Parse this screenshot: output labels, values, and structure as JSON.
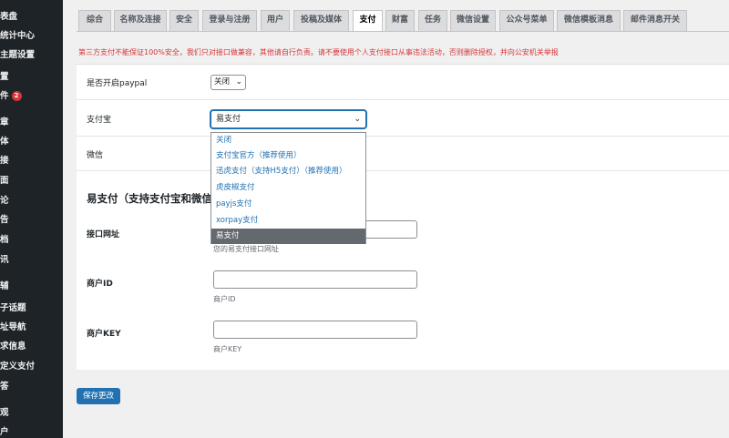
{
  "sidebar": {
    "items": [
      {
        "label": "表盘"
      },
      {
        "label": "统计中心"
      },
      {
        "label": "主题设置"
      },
      {
        "label": "置"
      },
      {
        "label": "件",
        "badge": "2"
      },
      {
        "label": "章"
      },
      {
        "label": "体"
      },
      {
        "label": "接"
      },
      {
        "label": "面"
      },
      {
        "label": "论"
      },
      {
        "label": "告"
      },
      {
        "label": "档"
      },
      {
        "label": "讯"
      },
      {
        "label": "辅"
      },
      {
        "label": "子话题"
      },
      {
        "label": "址导航"
      },
      {
        "label": "求信息"
      },
      {
        "label": "定义支付"
      },
      {
        "label": "答"
      },
      {
        "label": "观"
      },
      {
        "label": "户"
      }
    ]
  },
  "tabs": [
    {
      "label": "综合"
    },
    {
      "label": "名称及连接"
    },
    {
      "label": "安全"
    },
    {
      "label": "登录与注册"
    },
    {
      "label": "用户"
    },
    {
      "label": "投稿及媒体"
    },
    {
      "label": "支付",
      "active": true
    },
    {
      "label": "财富"
    },
    {
      "label": "任务"
    },
    {
      "label": "微信设置"
    },
    {
      "label": "公众号菜单"
    },
    {
      "label": "微信模板消息"
    },
    {
      "label": "邮件消息开关"
    }
  ],
  "warning": "第三方支付不能保证100%安全，我们只对接口做兼容，其他请自行负责。请不要使用个人支付接口从事违法活动，否则删除授权，并向公安机关举报",
  "form": {
    "paypal_label": "是否开启paypal",
    "paypal_value": "关闭",
    "alipay_label": "支付宝",
    "alipay_value": "易支付",
    "wechat_label": "微信",
    "section_title": "易支付（支持支付宝和微信",
    "api_url_label": "接口网址",
    "api_url_hint": "您的易支付接口网址",
    "merchant_id_label": "商户ID",
    "merchant_id_hint": "商户ID",
    "merchant_key_label": "商户KEY",
    "merchant_key_hint": "商户KEY"
  },
  "dropdown": {
    "options": [
      {
        "label": "关闭"
      },
      {
        "label": "支付宝官方（推荐使用）"
      },
      {
        "label": "迅虎支付（支持H5支付）（推荐使用）"
      },
      {
        "label": "虎皮椒支付"
      },
      {
        "label": "payjs支付"
      },
      {
        "label": "xorpay支付"
      },
      {
        "label": "易支付",
        "selected": true
      }
    ]
  },
  "save_label": "保存更改",
  "colors": {
    "sidebar_bg": "#1d2327",
    "accent": "#2271b1",
    "warning": "#d63638",
    "selected_option_bg": "#646970"
  }
}
